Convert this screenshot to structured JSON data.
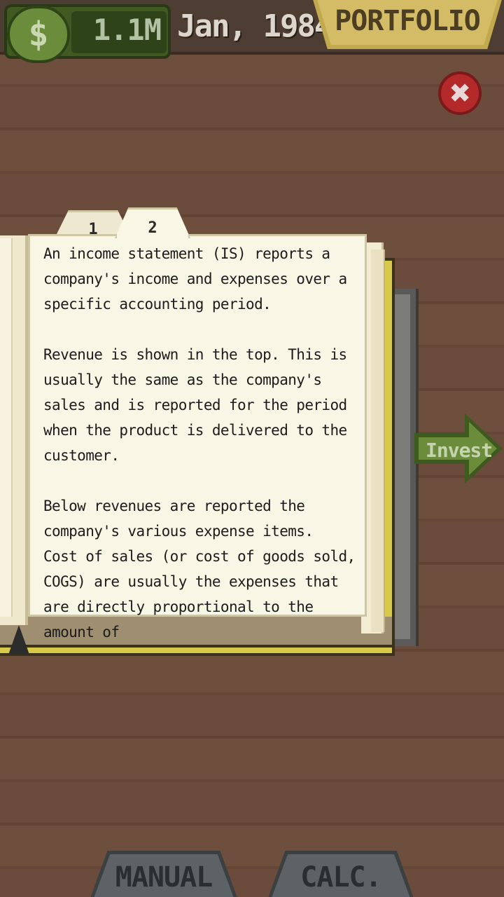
{
  "topbar": {
    "money_icon": "dollar-sign-icon",
    "money_value": "1.1M",
    "date": "Jan, 1984",
    "portfolio_label": "PORTFOLIO"
  },
  "close_icon": "✖",
  "book": {
    "tabs": [
      {
        "label": "1",
        "active": false
      },
      {
        "label": "2",
        "active": true
      }
    ],
    "paragraphs": [
      "An income statement (IS) reports a company's income and expenses over a specific accounting period.",
      "Revenue is shown in the top. This is usually the same as the company's sales and is reported for the period when the product is delivered to the customer.",
      "Below revenues are reported the company's various expense items.",
      "Cost of sales (or cost of goods sold, COGS) are usually the expenses that are directly proportional to the amount of"
    ]
  },
  "invest_label": "Invest",
  "bottom_tabs": {
    "manual": "MANUAL",
    "calc": "CALC."
  },
  "colors": {
    "background": "#6a4a3a",
    "money_green": "#405a22",
    "portfolio_gold": "#d4bc66",
    "close_red": "#b42a2a",
    "book_cover": "#d8c94a",
    "page": "#f8f6e4",
    "invest_green": "#6b8c3a",
    "tab_gray": "#5c6266"
  }
}
